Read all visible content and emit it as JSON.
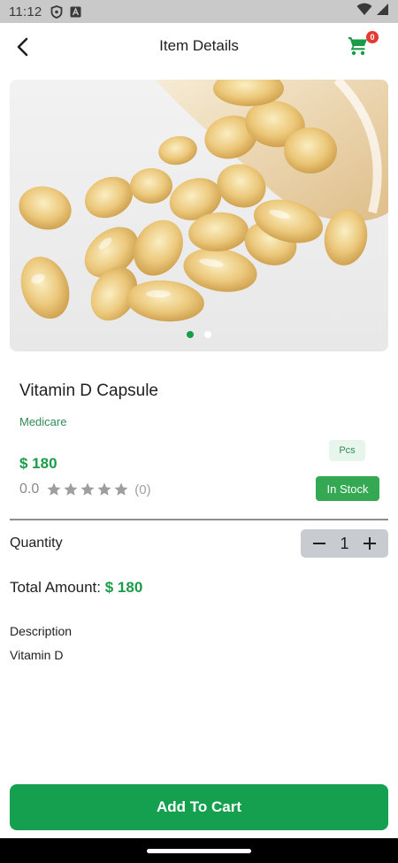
{
  "status_bar": {
    "time": "11:12",
    "icons": [
      "shield-icon",
      "a-icon",
      "wifi-icon",
      "signal-icon"
    ]
  },
  "app_bar": {
    "title": "Item Details",
    "cart_count": "0",
    "icons": [
      "arrow-back-icon",
      "cart-icon"
    ]
  },
  "carousel": {
    "image": "vitamin-d-softgel-capsules",
    "slides": 2,
    "active_slide": 1
  },
  "product": {
    "name": "Vitamin D Capsule",
    "brand": "Medicare",
    "price": "$ 180",
    "unit": "Pcs",
    "rating": "0.0",
    "rating_stars": 0,
    "rating_count": "(0)",
    "stock_status": "In Stock"
  },
  "quantity": {
    "label": "Quantity",
    "value": "1",
    "decrement": "−",
    "increment": "+"
  },
  "total": {
    "label": "Total Amount: ",
    "value": "$ 180"
  },
  "description": {
    "title": "Description",
    "text": "Vitamin D"
  },
  "actions": {
    "add_to_cart": "Add To Cart"
  },
  "colors": {
    "accent": "#1a9b48",
    "stock_badge": "#35a853",
    "cart_badge": "#e53935",
    "star_empty": "#9e9e9e"
  }
}
